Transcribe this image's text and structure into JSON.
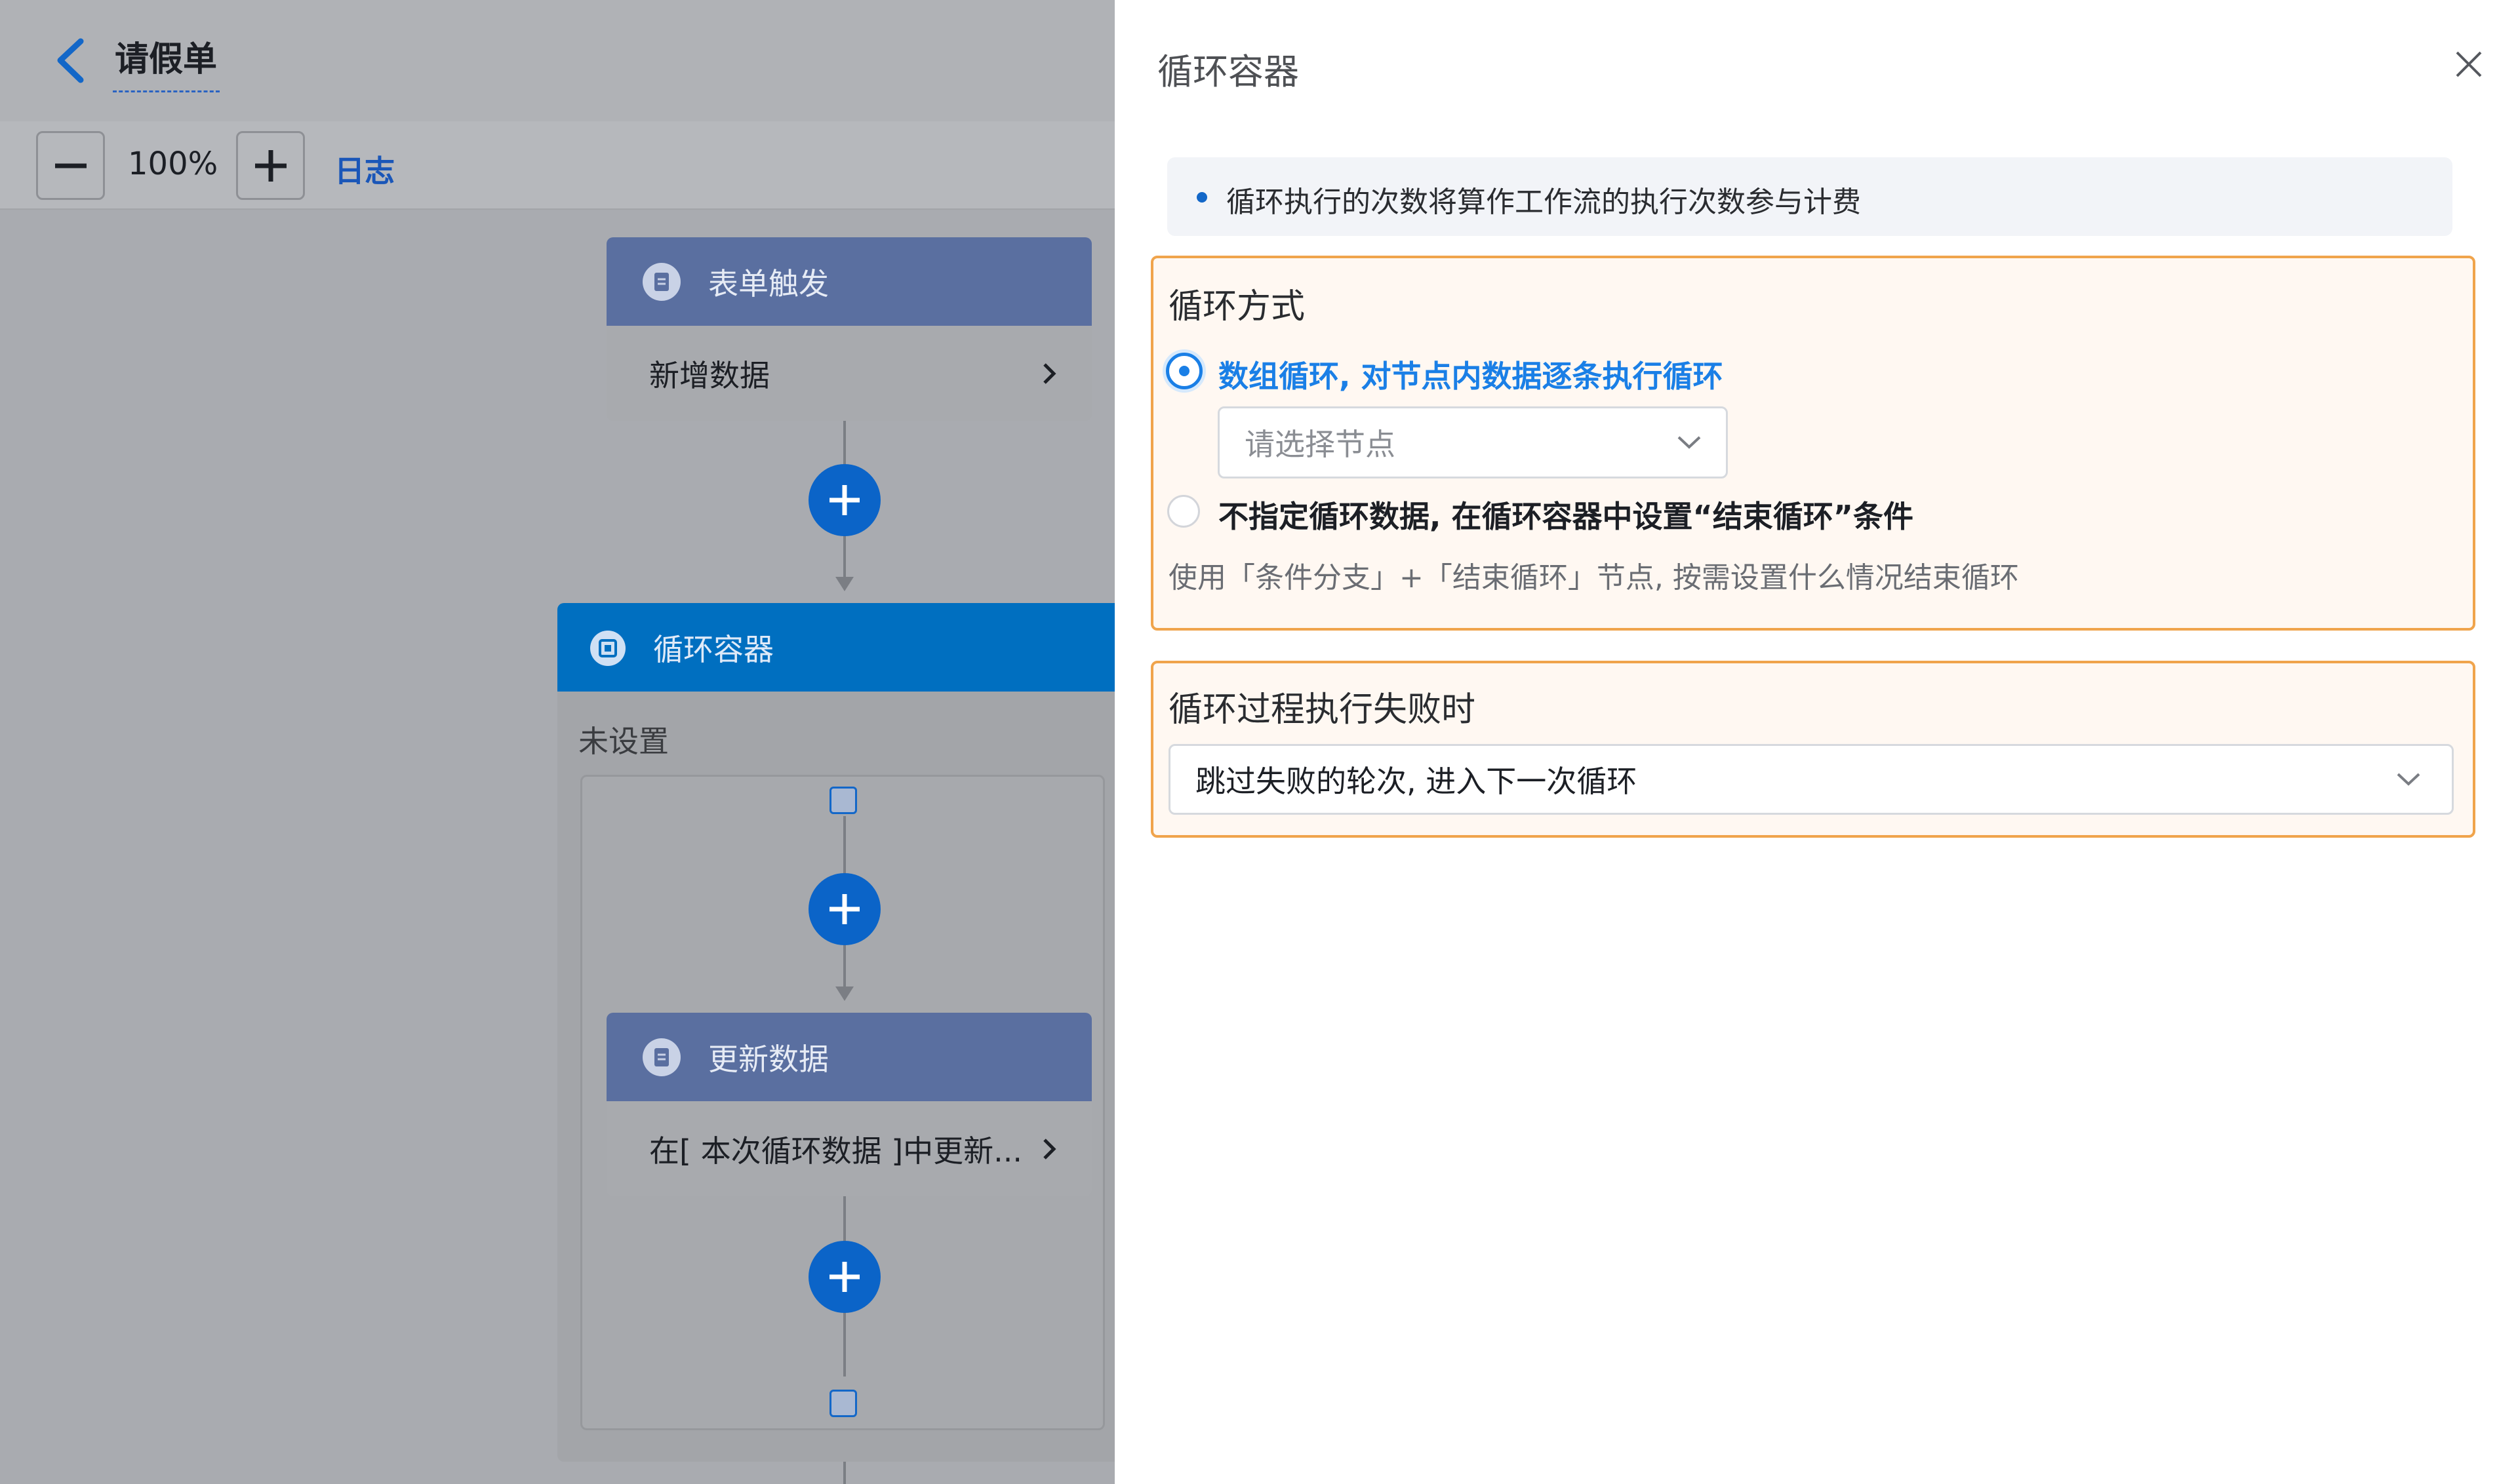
{
  "header": {
    "back_icon": "chevron-left-icon",
    "title": "请假单"
  },
  "toolbar": {
    "zoom_out_icon": "minus-icon",
    "zoom": "100%",
    "zoom_in_icon": "plus-icon",
    "log_label": "日志"
  },
  "flow": {
    "trigger": {
      "icon": "form-icon",
      "title": "表单触发",
      "detail": "新增数据"
    },
    "loop": {
      "icon": "loop-container-icon",
      "title": "循环容器",
      "status": "未设置"
    },
    "update": {
      "icon": "form-icon",
      "title": "更新数据",
      "detail": "在[ 本次循环数据 ]中更新..."
    }
  },
  "panel": {
    "title": "循环容器",
    "close_icon": "close-icon",
    "notice": "循环执行的次数将算作工作流的执行次数参与计费",
    "loop_mode": {
      "label": "循环方式",
      "option1": "数组循环, 对节点内数据逐条执行循环",
      "option1_selected": true,
      "node_placeholder": "请选择节点",
      "option2": "不指定循环数据, 在循环容器中设置“结束循环”条件",
      "option2_hint": "使用「条件分支」+「结束循环」节点, 按需设置什么情况结束循环"
    },
    "on_failure": {
      "label": "循环过程执行失败时",
      "value": "跳过失败的轮次, 进入下一次循环"
    }
  },
  "colors": {
    "accent": "#1a7fe6",
    "node_head": "#5a6fa0",
    "loop_head": "#006fc0",
    "highlight_border": "#f0a44c"
  }
}
